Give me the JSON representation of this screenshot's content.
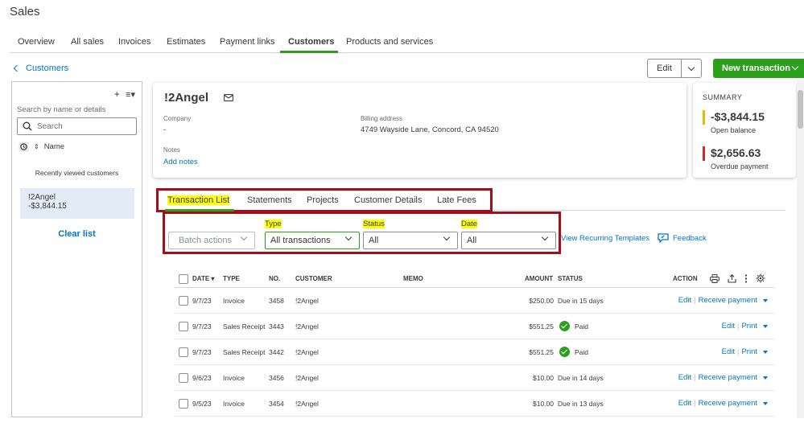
{
  "app": {
    "title": "Sales"
  },
  "topnav": {
    "tabs": [
      "Overview",
      "All sales",
      "Invoices",
      "Estimates",
      "Payment links",
      "Customers",
      "Products and services"
    ],
    "active": "Customers"
  },
  "back": {
    "label": "Customers"
  },
  "header_actions": {
    "edit_label": "Edit",
    "new_transaction_label": "New transaction"
  },
  "sidebar": {
    "search_hint": "Search by name or details",
    "search_placeholder": "Search",
    "sort_label": "Name",
    "recent_label": "Recently viewed customers",
    "selected_customer": {
      "name": "!2Angel",
      "balance": "-$3,844.15"
    },
    "clear_label": "Clear list"
  },
  "customer": {
    "name": "!2Angel",
    "company_label": "Company",
    "company_value": "-",
    "billing_label": "Billing address",
    "billing_value": "4749 Wayside Lane, Concord, CA 94520",
    "notes_label": "Notes",
    "add_notes_label": "Add notes"
  },
  "summary": {
    "title": "SUMMARY",
    "open_balance": "-$3,844.15",
    "open_balance_label": "Open balance",
    "overdue": "$2,656.63",
    "overdue_label": "Overdue payment",
    "open_color": "#f4b400",
    "overdue_color": "#d52b1e"
  },
  "subtabs": [
    "Transaction List",
    "Statements",
    "Projects",
    "Customer Details",
    "Late Fees"
  ],
  "filters": {
    "batch_label": "Batch actions",
    "type_label": "Type",
    "type_value": "All transactions",
    "status_label": "Status",
    "status_value": "All",
    "date_label": "Date",
    "date_value": "All",
    "recurring_label": "View Recurring Templates",
    "feedback_label": "Feedback"
  },
  "table": {
    "headers": {
      "date": "DATE",
      "type": "TYPE",
      "no": "NO.",
      "customer": "CUSTOMER",
      "memo": "MEMO",
      "amount": "AMOUNT",
      "status": "STATUS",
      "action": "ACTION"
    },
    "rows": [
      {
        "date": "9/7/23",
        "type": "Invoice",
        "no": "3458",
        "customer": "!2Angel",
        "amount": "$250.00",
        "status": "Due in 15 days",
        "paid": false,
        "action1": "Edit",
        "action2": "Receive payment"
      },
      {
        "date": "9/7/23",
        "type": "Sales Receipt",
        "no": "3443",
        "customer": "!2Angel",
        "amount": "$551.25",
        "status": "Paid",
        "paid": true,
        "action1": "Edit",
        "action2": "Print"
      },
      {
        "date": "9/7/23",
        "type": "Sales Receipt",
        "no": "3442",
        "customer": "!2Angel",
        "amount": "$551.25",
        "status": "Paid",
        "paid": true,
        "action1": "Edit",
        "action2": "Print"
      },
      {
        "date": "9/6/23",
        "type": "Invoice",
        "no": "3456",
        "customer": "!2Angel",
        "amount": "$10.00",
        "status": "Due in 14 days",
        "paid": false,
        "action1": "Edit",
        "action2": "Receive payment"
      },
      {
        "date": "9/5/23",
        "type": "Invoice",
        "no": "3454",
        "customer": "!2Angel",
        "amount": "$10.00",
        "status": "Due in 13 days",
        "paid": false,
        "action1": "Edit",
        "action2": "Receive payment"
      }
    ]
  },
  "colors": {
    "brand_green": "#2ca01c",
    "link_blue": "#0077c5",
    "highlight_red": "#a50e18",
    "highlight_yellow": "#ffff00"
  }
}
